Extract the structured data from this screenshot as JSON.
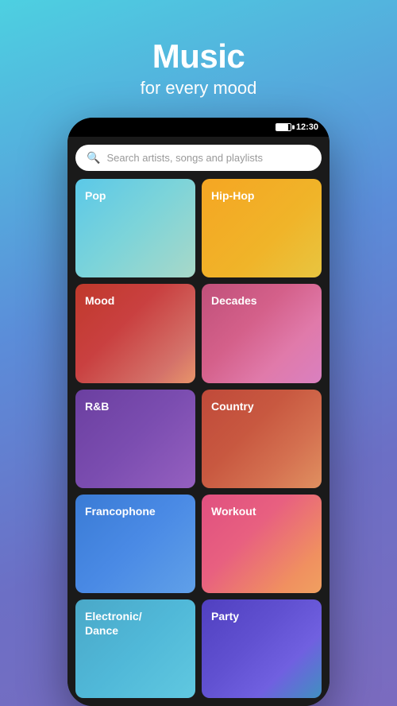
{
  "header": {
    "title": "Music",
    "subtitle": "for every mood"
  },
  "status_bar": {
    "time": "12:30"
  },
  "search": {
    "placeholder": "Search artists, songs and playlists"
  },
  "grid_items": [
    {
      "id": "pop",
      "label": "Pop",
      "class": "pop"
    },
    {
      "id": "hiphop",
      "label": "Hip-Hop",
      "class": "hiphop"
    },
    {
      "id": "mood",
      "label": "Mood",
      "class": "mood"
    },
    {
      "id": "decades",
      "label": "Decades",
      "class": "decades"
    },
    {
      "id": "rnb",
      "label": "R&B",
      "class": "rnb"
    },
    {
      "id": "country",
      "label": "Country",
      "class": "country"
    },
    {
      "id": "francophone",
      "label": "Francophone",
      "class": "francophone"
    },
    {
      "id": "workout",
      "label": "Workout",
      "class": "workout"
    },
    {
      "id": "electronic",
      "label": "Electronic/ Dance",
      "class": "electronic"
    },
    {
      "id": "party",
      "label": "Party",
      "class": "party"
    }
  ]
}
